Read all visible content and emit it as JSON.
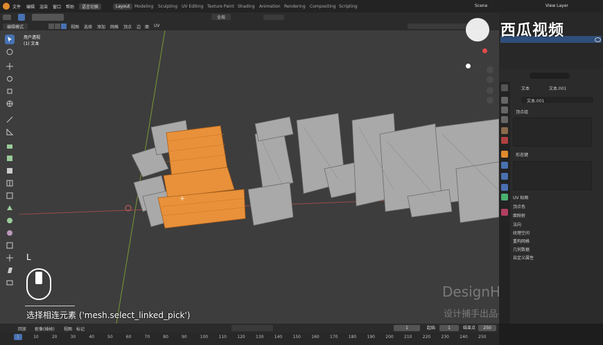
{
  "topbar": {
    "menus": [
      "文件",
      "编辑",
      "渲染",
      "窗口",
      "帮助"
    ],
    "mode_switch": "语言切换",
    "workspaces": [
      "Layout",
      "Modeling",
      "Sculpting",
      "UV Editing",
      "Texture Paint",
      "Shading",
      "Animation",
      "Rendering",
      "Compositing",
      "Scripting"
    ],
    "scene": "Scene",
    "view_layer": "View Layer"
  },
  "header": {
    "mode": "编辑模式",
    "menus": [
      "视图",
      "选择",
      "添加",
      "网格",
      "顶点",
      "边",
      "面",
      "UV"
    ],
    "transform_orientation": "全局"
  },
  "viewport": {
    "view_name": "用户透视",
    "object_name": "(1) 文本",
    "key_hint": "L",
    "operator_text": "选择相连元素 ('mesh.select_linked_pick')",
    "watermark_title": "DesignHunting",
    "watermark_sub": "设计捕手出品-基础部分",
    "logo_text": "西瓜视频"
  },
  "properties": {
    "breadcrumb_object": "文本",
    "breadcrumb_mesh": "文本.001",
    "mesh_name": "文本.001",
    "section_vertex_groups": "顶点组",
    "section_shape_keys": "形态键",
    "subsections": [
      "UV 贴图",
      "顶点色",
      "面映射",
      "法向",
      "纹理空间",
      "重构网格",
      "几何数据",
      "自定义属性"
    ]
  },
  "timeline": {
    "menus": [
      "回放",
      "抠像(插帧)",
      "视图",
      "标记"
    ],
    "current_frame": "1",
    "start_label": "起始",
    "start_value": "1",
    "end_label": "结束点",
    "end_value": "250",
    "ruler_ticks": [
      "1",
      "10",
      "20",
      "30",
      "40",
      "50",
      "60",
      "70",
      "80",
      "90",
      "100",
      "110",
      "120",
      "130",
      "140",
      "150",
      "160",
      "170",
      "180",
      "190",
      "200",
      "210",
      "220",
      "230",
      "240",
      "250"
    ]
  },
  "colors": {
    "selection_orange": "#e8913a",
    "mesh_gray": "#a9a9a9",
    "viewport_bg": "#3d3d3d",
    "active_blue": "#4772b3"
  }
}
